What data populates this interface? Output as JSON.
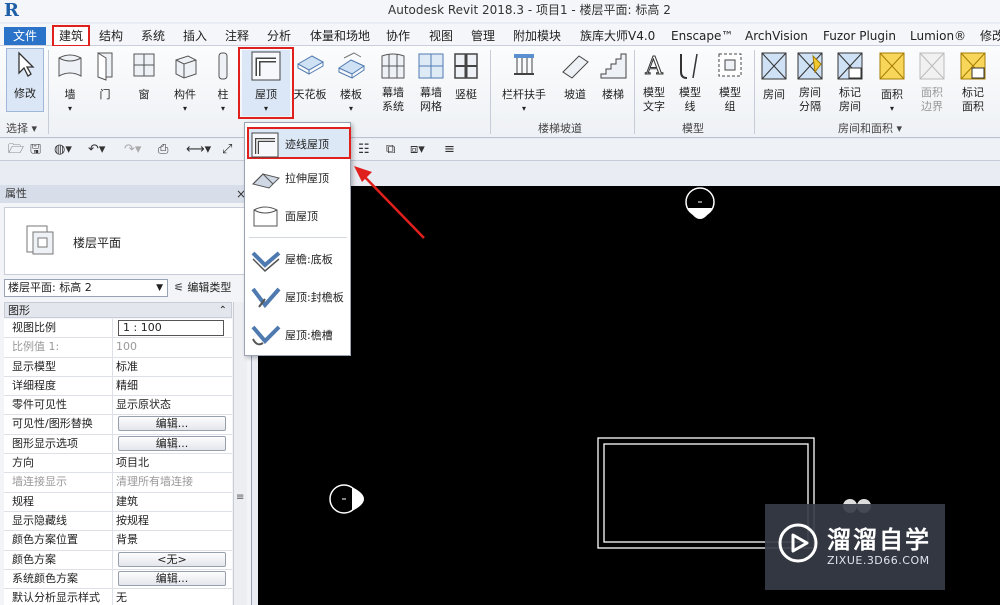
{
  "app": {
    "logo": "R",
    "window_title": "Autodesk Revit 2018.3 -    项目1 - 楼层平面: 标高 2"
  },
  "tabs": [
    {
      "label": "文件"
    },
    {
      "label": "建筑"
    },
    {
      "label": "结构"
    },
    {
      "label": "系统"
    },
    {
      "label": "插入"
    },
    {
      "label": "注释"
    },
    {
      "label": "分析"
    },
    {
      "label": "体量和场地"
    },
    {
      "label": "协作"
    },
    {
      "label": "视图"
    },
    {
      "label": "管理"
    },
    {
      "label": "附加模块"
    },
    {
      "label": "族库大师V4.0"
    },
    {
      "label": "Enscape™"
    },
    {
      "label": "ArchVision"
    },
    {
      "label": "Fuzor Plugin"
    },
    {
      "label": "Lumion®"
    },
    {
      "label": "修改"
    }
  ],
  "ribbon": {
    "modify": "修改",
    "select": "选择 ▾",
    "wall": "墙",
    "door": "门",
    "window": "窗",
    "component": "构件",
    "column": "柱",
    "roof": "屋顶",
    "ceiling": "天花板",
    "floor": "楼板",
    "curtain_system_1": "幕墙",
    "curtain_system_2": "系统",
    "curtain_grid_1": "幕墙",
    "curtain_grid_2": "网格",
    "mullion": "竖梃",
    "railing": "栏杆扶手",
    "ramp": "坡道",
    "stair": "楼梯",
    "circulation_panel": "楼梯坡道",
    "model_text_1": "模型",
    "model_text_2": "文字",
    "model_line_1": "模型",
    "model_line_2": "线",
    "model_group_1": "模型",
    "model_group_2": "组",
    "model_panel": "模型",
    "room": "房间",
    "room_sep_1": "房间",
    "room_sep_2": "分隔",
    "tag_room_1": "标记",
    "tag_room_2": "房间",
    "area": "面积",
    "area_boundary_1": "面积",
    "area_boundary_2": "边界",
    "tag_area_1": "标记",
    "tag_area_2": "面积",
    "room_area_panel": "房间和面积 ▾"
  },
  "roof_menu": [
    {
      "label": "迹线屋顶"
    },
    {
      "label": "拉伸屋顶"
    },
    {
      "label": "面屋顶"
    },
    {
      "label": "屋檐:底板"
    },
    {
      "label": "屋顶:封檐板"
    },
    {
      "label": "屋顶:檐槽"
    }
  ],
  "properties": {
    "title": "属性",
    "close": "×",
    "type_name": "楼层平面",
    "view_selector": "楼层平面: 标高 2",
    "edit_type": "编辑类型",
    "group_graphics": "图形",
    "rows": [
      {
        "k": "视图比例",
        "v": "1 : 100"
      },
      {
        "k": "比例值 1:",
        "v": "100"
      },
      {
        "k": "显示模型",
        "v": "标准"
      },
      {
        "k": "详细程度",
        "v": "精细"
      },
      {
        "k": "零件可见性",
        "v": "显示原状态"
      },
      {
        "k": "可见性/图形替换",
        "v": "编辑..."
      },
      {
        "k": "图形显示选项",
        "v": "编辑..."
      },
      {
        "k": "方向",
        "v": "项目北"
      },
      {
        "k": "墙连接显示",
        "v": "清理所有墙连接"
      },
      {
        "k": "规程",
        "v": "建筑"
      },
      {
        "k": "显示隐藏线",
        "v": "按规程"
      },
      {
        "k": "颜色方案位置",
        "v": "背景"
      },
      {
        "k": "颜色方案",
        "v": "<无>"
      },
      {
        "k": "系统颜色方案",
        "v": "编辑..."
      },
      {
        "k": "默认分析显示样式",
        "v": "无"
      }
    ]
  },
  "watermark": {
    "title": "溜溜自学",
    "subtitle": "ZIXUE.3D66.COM"
  },
  "colors": {
    "accent": "#2a73c8",
    "highlight": "#e0201c",
    "canvas": "#000000"
  }
}
